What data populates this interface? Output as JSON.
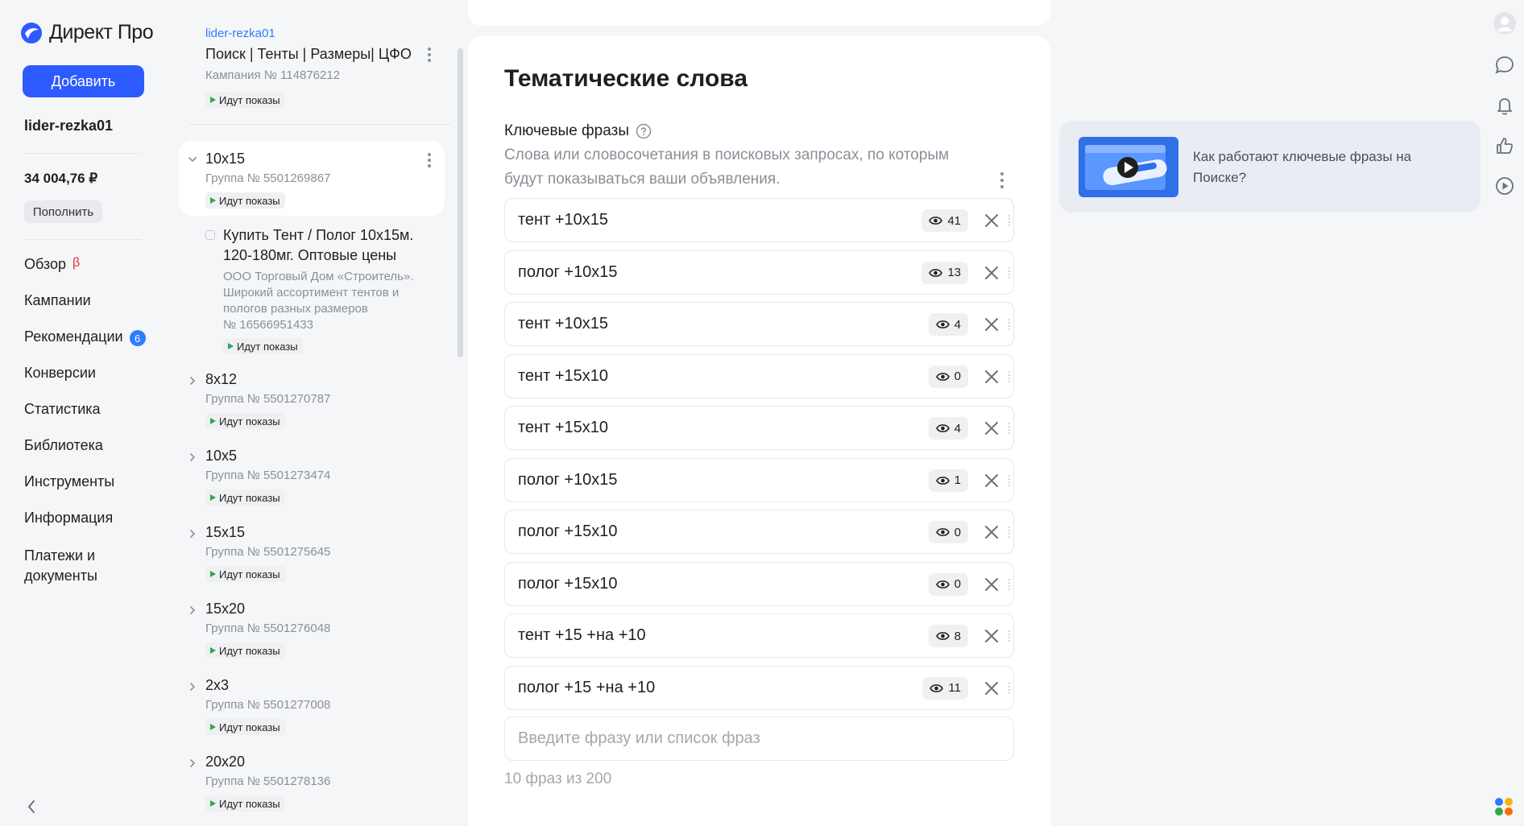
{
  "nav": {
    "logo_text": "Директ Про",
    "add_button": "Добавить",
    "account": "lider-rezka01",
    "balance": "34 004,76 ₽",
    "topup_button": "Пополнить",
    "items": [
      {
        "label": "Обзор",
        "beta": "β"
      },
      {
        "label": "Кампании"
      },
      {
        "label": "Рекомендации",
        "badge": "6"
      },
      {
        "label": "Конверсии"
      },
      {
        "label": "Статистика"
      },
      {
        "label": "Библиотека"
      },
      {
        "label": "Инструменты"
      },
      {
        "label": "Информация"
      },
      {
        "label": "Платежи и документы"
      }
    ]
  },
  "campaign": {
    "account": "lider-rezka01",
    "title": "Поиск | Тенты | Размеры| ЦФО",
    "number": "Кампания № 114876212",
    "status": "Идут показы"
  },
  "selected_group": {
    "name": "10x15",
    "number": "Группа № 5501269867",
    "status": "Идут показы"
  },
  "ad": {
    "title": "Купить Тент / Полог 10x15м. 120-180мг. Оптовые цены",
    "description": "ООО Торговый Дом «Строитель». Широкий ассортимент тентов и пологов разных размеров",
    "number": "№ 16566951433",
    "status": "Идут показы"
  },
  "groups": [
    {
      "name": "8x12",
      "number": "Группа № 5501270787",
      "status": "Идут показы"
    },
    {
      "name": "10x5",
      "number": "Группа № 5501273474",
      "status": "Идут показы"
    },
    {
      "name": "15x15",
      "number": "Группа № 5501275645",
      "status": "Идут показы"
    },
    {
      "name": "15x20",
      "number": "Группа № 5501276048",
      "status": "Идут показы"
    },
    {
      "name": "2x3",
      "number": "Группа № 5501277008",
      "status": "Идут показы"
    },
    {
      "name": "20x20",
      "number": "Группа № 5501278136",
      "status": "Идут показы"
    }
  ],
  "main": {
    "title": "Тематические слова",
    "keywords_label": "Ключевые фразы",
    "keywords_description": "Слова или словосочетания в поисковых запросах, по которым будут показываться ваши объявления.",
    "phrases": [
      {
        "text": "тент +10x15",
        "shows": "41"
      },
      {
        "text": "полог +10x15",
        "shows": "13"
      },
      {
        "text": "тент +10x15",
        "shows": "4"
      },
      {
        "text": "тент +15x10",
        "shows": "0"
      },
      {
        "text": "тент +15x10",
        "shows": "4"
      },
      {
        "text": "полог +10x15",
        "shows": "1"
      },
      {
        "text": "полог +15x10",
        "shows": "0"
      },
      {
        "text": "полог +15x10",
        "shows": "0"
      },
      {
        "text": "тент +15 +на +10",
        "shows": "8"
      },
      {
        "text": "полог +15 +на +10",
        "shows": "11"
      }
    ],
    "input_placeholder": "Введите фразу или список фраз",
    "count": "10 фраз из 200"
  },
  "help_card": {
    "text": "Как работают ключевые фразы на Поиске?"
  },
  "colors": {
    "accent": "#2e5bff",
    "status_play": "#2ca94b",
    "beta": "#e0312c"
  }
}
